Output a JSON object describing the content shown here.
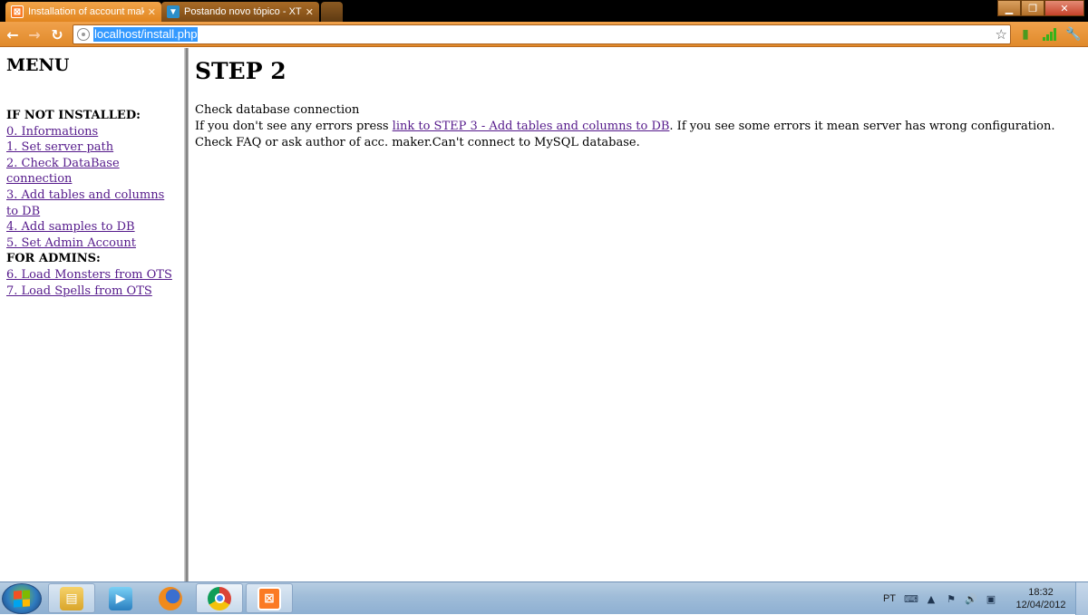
{
  "browser": {
    "tabs": [
      {
        "title": "Installation of account mak",
        "favicon": "xampp-icon",
        "active": true
      },
      {
        "title": "Postando novo tópico - XT",
        "favicon": "forum-icon",
        "active": false
      }
    ],
    "url": "localhost/install.php",
    "window_controls": [
      "minimize",
      "restore",
      "close"
    ]
  },
  "sidebar": {
    "title": "MENU",
    "sections": [
      {
        "heading": "IF NOT INSTALLED:",
        "links": [
          "0. Informations",
          "1. Set server path",
          "2. Check DataBase connection",
          "3. Add tables and columns to DB",
          "4. Add samples to DB",
          "5. Set Admin Account"
        ]
      },
      {
        "heading": "FOR ADMINS:",
        "links": [
          "6. Load Monsters from OTS",
          "7. Load Spells from OTS"
        ]
      }
    ]
  },
  "main": {
    "title": "STEP 2",
    "line1": "Check database connection",
    "line2_before": "If you don't see any errors press ",
    "line2_link": "link to STEP 3 - Add tables and columns to DB",
    "line2_after": ". If you see some errors it mean server has wrong configuration. Check FAQ or ask author of acc. maker.Can't connect to MySQL database."
  },
  "taskbar": {
    "apps": [
      "explorer-icon",
      "media-player-icon",
      "firefox-icon",
      "chrome-icon",
      "xampp-icon"
    ],
    "language": "PT",
    "time": "18:32",
    "date": "12/04/2012"
  },
  "colors": {
    "chrome_accent": "#e8922f",
    "visited_link": "#551a8b",
    "selection": "#3399ff"
  }
}
